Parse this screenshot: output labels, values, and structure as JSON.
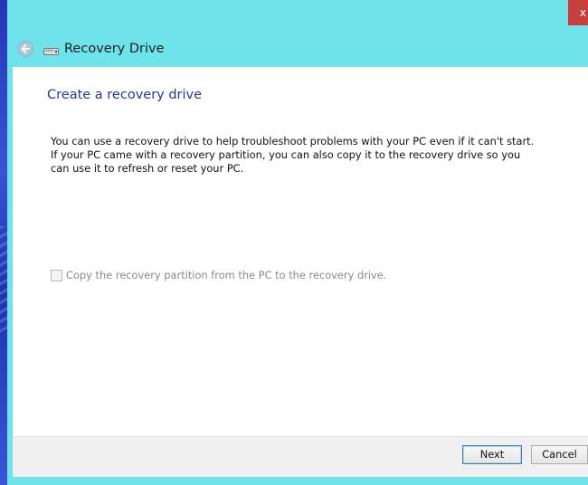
{
  "window": {
    "close_glyph": "x",
    "accent_color": "#6ee3ea"
  },
  "header": {
    "title": "Recovery Drive",
    "back_icon": "back-arrow-icon",
    "drive_icon": "drive-icon"
  },
  "content": {
    "page_title": "Create a recovery drive",
    "description": "You can use a recovery drive to help troubleshoot problems with your PC even if it can't start. If your PC came with a recovery partition, you can also copy it to the recovery drive so you can use it to refresh or reset your PC.",
    "checkbox": {
      "label": "Copy the recovery partition from the PC to the recovery drive.",
      "checked": false,
      "enabled": false
    }
  },
  "footer": {
    "next_label": "Next",
    "cancel_label": "Cancel"
  }
}
